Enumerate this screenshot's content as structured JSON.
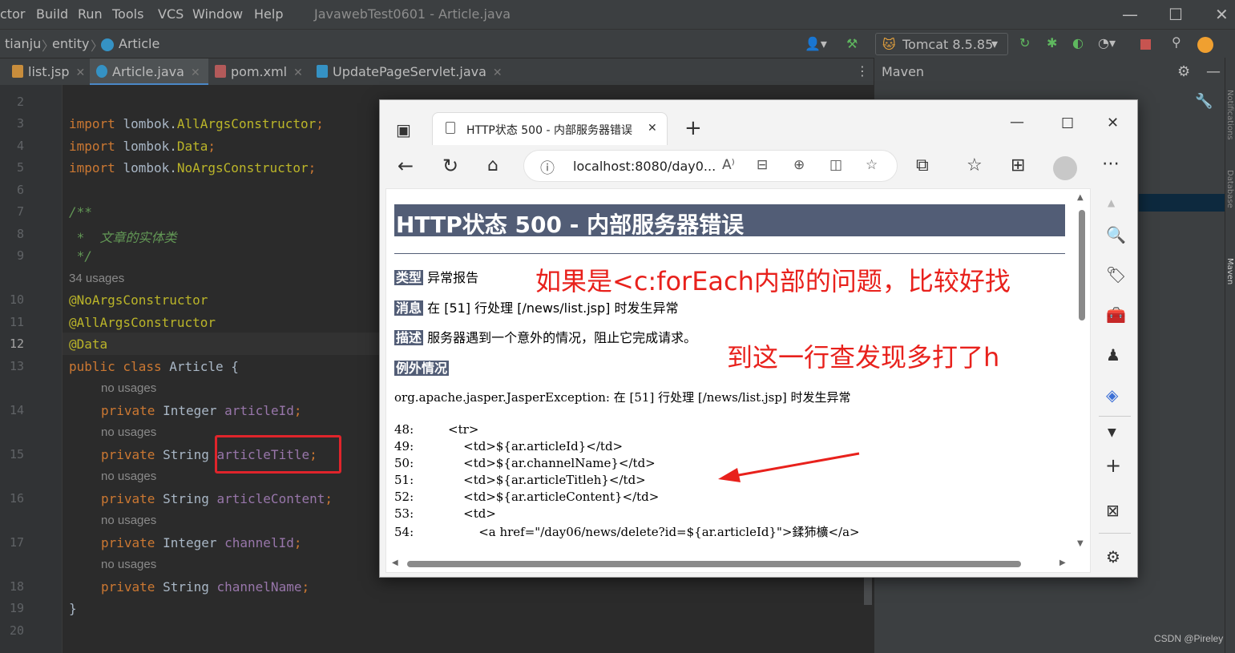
{
  "ide": {
    "menu": [
      "ctor",
      "Build",
      "Run",
      "Tools",
      "VCS",
      "Window",
      "Help"
    ],
    "window_title": "JavawebTest0601 - Article.java",
    "breadcrumb": [
      "tianju",
      "entity",
      "Article"
    ],
    "run_config": "Tomcat 8.5.85",
    "tabs": [
      "list.jsp",
      "Article.java",
      "pom.xml",
      "UpdatePageServlet.java"
    ],
    "maven_title": "Maven",
    "side_labels": [
      "Notifications",
      "Database",
      "Maven"
    ],
    "code": {
      "ln2": "2",
      "ln3": "3",
      "imp1_kw": "import",
      "imp1_pkg": "lombok.",
      "imp1_cls": "AllArgsConstructor",
      "imp1_end": ";",
      "ln4": "4",
      "imp2_kw": "import",
      "imp2_pkg": "lombok.",
      "imp2_cls": "Data",
      "imp2_end": ";",
      "ln5": "5",
      "imp3_kw": "import",
      "imp3_pkg": "lombok.",
      "imp3_cls": "NoArgsConstructor",
      "imp3_end": ";",
      "ln6": "6",
      "ln7": "7",
      "doc_open": "/**",
      "ln8": "8",
      "doc_text": " *  文章的实体类",
      "ln9": "9",
      "doc_close": " */",
      "usages": "34 usages",
      "ln10": "10",
      "ann1": "@NoArgsConstructor",
      "ln11": "11",
      "ann2": "@AllArgsConstructor",
      "ln12": "12",
      "ann3": "@Data",
      "ln13": "13",
      "cls_kw": "public class",
      "cls_name": " Article {",
      "no_usages": "no usages",
      "ln14": "14",
      "f1_kw": "private",
      "f1_type": " Integer ",
      "f1_name": "articleId",
      "ln15": "15",
      "f2_kw": "private",
      "f2_type": " String ",
      "f2_name": "articleTitle",
      "ln16": "16",
      "f3_kw": "private",
      "f3_type": " String ",
      "f3_name": "articleContent",
      "ln17": "17",
      "f4_kw": "private",
      "f4_type": " Integer ",
      "f4_name": "channelId",
      "ln18": "18",
      "f5_kw": "private",
      "f5_type": " String ",
      "f5_name": "channelName",
      "ln19": "19",
      "close_brace": "}",
      "ln20": "20",
      "semi": ";"
    }
  },
  "browser": {
    "tab_title": "HTTP状态 500 - 内部服务器错误",
    "address": "localhost:8080/day0...",
    "page": {
      "h1": "HTTP状态 500 - 内部服务器错误",
      "type_label": "类型",
      "type_value": "异常报告",
      "message_label": "消息",
      "message_value": "在 [51] 行处理 [/news/list.jsp] 时发生异常",
      "desc_label": "描述",
      "desc_value": "服务器遇到一个意外的情况，阻止它完成请求。",
      "exception_label": "例外情况",
      "exception_text": "org.apache.jasper.JasperException: 在 [51] 行处理 [/news/list.jsp] 时发生异常",
      "source_lines": [
        "48:         <tr>",
        "49:             <td>${ar.articleId}</td>",
        "50:             <td>${ar.channelName}</td>",
        "51:             <td>${ar.articleTitleh}</td>",
        "52:             <td>${ar.articleContent}</td>",
        "53:             <td>",
        "54:                 <a href=\"/day06/news/delete?id=${ar.articleId}\">鍒犻櫎</a>"
      ]
    }
  },
  "annotations": {
    "note1": "如果是<c:forEach内部的问题，比较好找",
    "note2": "到这一行查发现多打了h",
    "watermark": "CSDN @Pireley"
  },
  "colors": {
    "annotation_red": "#e8211c",
    "tomcat_header": "#525d76"
  }
}
